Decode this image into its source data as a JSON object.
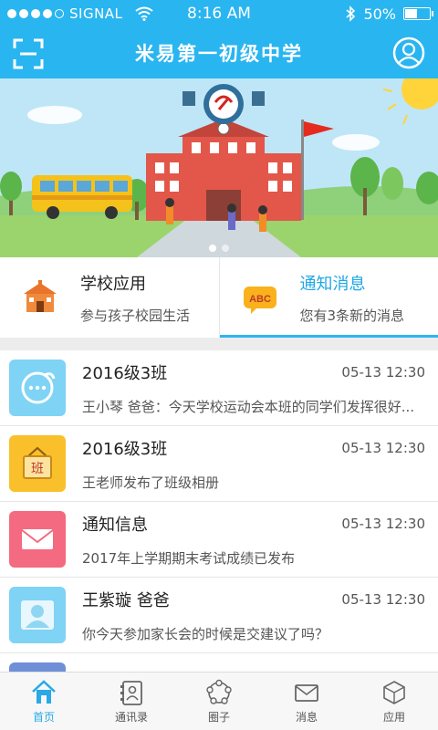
{
  "status_bar": {
    "carrier": "SIGNAL",
    "time": "8:16 AM",
    "battery_text": "50%",
    "battery_level": 0.5,
    "signal_bars": 4
  },
  "header": {
    "title": "米易第一初级中学",
    "scan_icon": "scan-icon",
    "profile_icon": "user-profile-icon"
  },
  "banner": {
    "slides": 2,
    "active_slide": 0
  },
  "tabs": [
    {
      "title": "学校应用",
      "subtitle": "参与孩子校园生活",
      "icon": "school-building-icon",
      "active": false
    },
    {
      "title": "通知消息",
      "subtitle": "您有3条新的消息",
      "icon": "abc-chat-icon",
      "active": true
    }
  ],
  "messages": [
    {
      "title": "2016级3班",
      "time": "05-13 12:30",
      "preview": "王小琴 爸爸：今天学校运动会本班的同学们发挥很好...",
      "icon": "chat-bubble-icon",
      "color": "#7fd3f5"
    },
    {
      "title": "2016级3班",
      "time": "05-13 12:30",
      "preview": "王老师发布了班级相册",
      "icon": "class-sign-icon",
      "color": "#f9c02b"
    },
    {
      "title": "通知信息",
      "time": "05-13 12:30",
      "preview": "2017年上学期期末考试成绩已发布",
      "icon": "envelope-icon",
      "color": "#f46a80"
    },
    {
      "title": "王紫璇 爸爸",
      "time": "05-13 12:30",
      "preview": "你今天参加家长会的时候是交建议了吗？",
      "icon": "person-icon",
      "color": "#7fd3f5"
    }
  ],
  "nav": [
    {
      "label": "首页",
      "icon": "home-icon",
      "active": true
    },
    {
      "label": "通讯录",
      "icon": "contacts-book-icon",
      "active": false
    },
    {
      "label": "圈子",
      "icon": "circle-group-icon",
      "active": false
    },
    {
      "label": "消息",
      "icon": "mail-icon",
      "active": false
    },
    {
      "label": "应用",
      "icon": "apps-cube-icon",
      "active": false
    }
  ],
  "colors": {
    "accent": "#29b5f0",
    "active_tab_text": "#1ea8e6"
  }
}
